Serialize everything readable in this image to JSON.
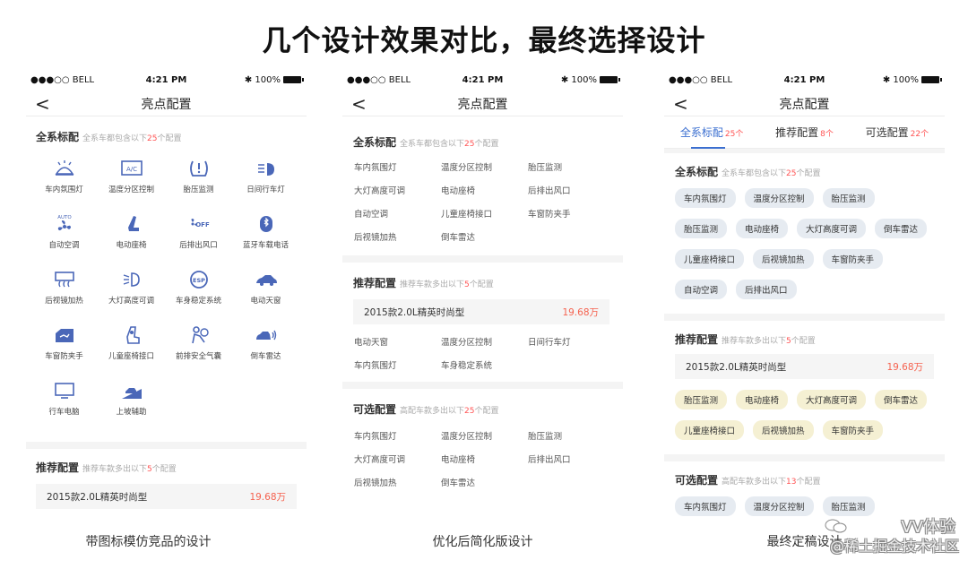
{
  "main_title": "几个设计效果对比，最终选择设计",
  "status_bar": {
    "carrier": "●●●○○ BELL",
    "time": "4:21 PM",
    "battery": "100%"
  },
  "nav_title": "亮点配置",
  "back_glyph": "<",
  "accent_color": "#3b6fd0",
  "price_color": "#f5624f",
  "phone1": {
    "section1": {
      "title": "全系标配",
      "sub_pre": "全系车都包含以下",
      "sub_num": "25",
      "sub_post": "个配置"
    },
    "icons": [
      {
        "label": "车内氛围灯",
        "icon": "ambient-light-icon"
      },
      {
        "label": "温度分区控制",
        "icon": "ac-zone-icon"
      },
      {
        "label": "胎压监测",
        "icon": "tire-pressure-icon"
      },
      {
        "label": "日间行车灯",
        "icon": "daytime-light-icon"
      },
      {
        "label": "自动空调",
        "icon": "auto-ac-icon"
      },
      {
        "label": "电动座椅",
        "icon": "power-seat-icon"
      },
      {
        "label": "后排出风口",
        "icon": "rear-vent-icon"
      },
      {
        "label": "蓝牙车载电话",
        "icon": "bluetooth-phone-icon"
      },
      {
        "label": "后视镜加热",
        "icon": "mirror-heat-icon"
      },
      {
        "label": "大灯高度可调",
        "icon": "headlight-adjust-icon"
      },
      {
        "label": "车身稳定系统",
        "icon": "esp-icon"
      },
      {
        "label": "电动天窗",
        "icon": "sunroof-icon"
      },
      {
        "label": "车窗防夹手",
        "icon": "anti-pinch-icon"
      },
      {
        "label": "儿童座椅接口",
        "icon": "child-seat-icon"
      },
      {
        "label": "前排安全气囊",
        "icon": "airbag-icon"
      },
      {
        "label": "倒车雷达",
        "icon": "parking-radar-icon"
      },
      {
        "label": "行车电脑",
        "icon": "trip-computer-icon"
      },
      {
        "label": "上坡辅助",
        "icon": "hill-assist-icon"
      }
    ],
    "section2": {
      "title": "推荐配置",
      "sub_pre": "推荐车款多出以下",
      "sub_num": "5",
      "sub_post": "个配置"
    },
    "price_row": {
      "name": "2015款2.0L精英时尚型",
      "price": "19.68万"
    },
    "icon_texts": {
      "ac": "A/C",
      "auto": "AUTO",
      "off": "OFF",
      "esp": "ESP"
    }
  },
  "phone2": {
    "section1": {
      "title": "全系标配",
      "sub_pre": "全系车都包含以下",
      "sub_num": "25",
      "sub_post": "个配置"
    },
    "standard_items": [
      "车内氛围灯",
      "温度分区控制",
      "胎压监测",
      "大灯高度可调",
      "电动座椅",
      "后排出风口",
      "自动空调",
      "儿童座椅接口",
      "车窗防夹手",
      "后视镜加热",
      "倒车雷达"
    ],
    "section2": {
      "title": "推荐配置",
      "sub_pre": "推荐车款多出以下",
      "sub_num": "5",
      "sub_post": "个配置"
    },
    "price_row": {
      "name": "2015款2.0L精英时尚型",
      "price": "19.68万"
    },
    "recommended_items": [
      "电动天窗",
      "温度分区控制",
      "日间行车灯",
      "车内氛围灯",
      "车身稳定系统"
    ],
    "section3": {
      "title": "可选配置",
      "sub_pre": "高配车款多出以下",
      "sub_num": "25",
      "sub_post": "个配置"
    },
    "optional_items": [
      "车内氛围灯",
      "温度分区控制",
      "胎压监测",
      "大灯高度可调",
      "电动座椅",
      "后排出风口",
      "后视镜加热",
      "倒车雷达"
    ]
  },
  "phone3": {
    "tabs": [
      {
        "label": "全系标配",
        "count": "25个"
      },
      {
        "label": "推荐配置",
        "count": "8个"
      },
      {
        "label": "可选配置",
        "count": "22个"
      }
    ],
    "section1": {
      "title": "全系标配",
      "sub_pre": "全系车都包含以下",
      "sub_num": "25",
      "sub_post": "个配置"
    },
    "standard_chips": [
      "车内氛围灯",
      "温度分区控制",
      "胎压监测",
      "胎压监测",
      "电动座椅",
      "大灯高度可调",
      "倒车雷达",
      "儿童座椅接口",
      "后视镜加热",
      "车窗防夹手",
      "自动空调",
      "后排出风口"
    ],
    "section2": {
      "title": "推荐配置",
      "sub_pre": "推荐车款多出以下",
      "sub_num": "5",
      "sub_post": "个配置"
    },
    "price_row": {
      "name": "2015款2.0L精英时尚型",
      "price": "19.68万"
    },
    "recommended_chips": [
      "胎压监测",
      "电动座椅",
      "大灯高度可调",
      "倒车雷达",
      "儿童座椅接口",
      "后视镜加热",
      "车窗防夹手"
    ],
    "section3": {
      "title": "可选配置",
      "sub_pre": "高配车款多出以下",
      "sub_num": "13",
      "sub_post": "个配置"
    },
    "optional_chips": [
      "车内氛围灯",
      "温度分区控制",
      "胎压监测"
    ]
  },
  "captions": [
    "带图标模仿竞品的设计",
    "优化后简化版设计",
    "最终定稿设计"
  ],
  "watermark": {
    "line1": "VV体验",
    "line2": "@稀土掘金技术社区"
  }
}
